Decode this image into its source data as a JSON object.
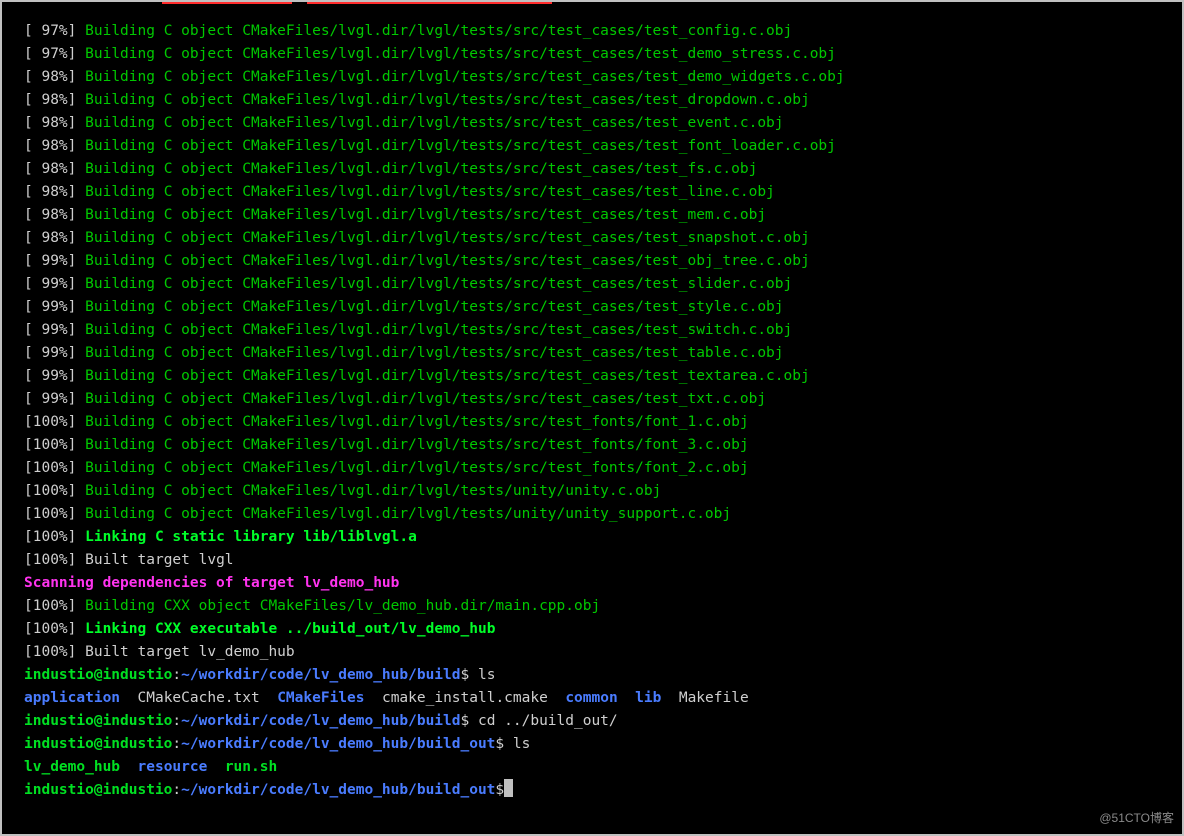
{
  "lines": [
    {
      "pct": " 97%",
      "kind": "build",
      "text": "Building C object CMakeFiles/lvgl.dir/lvgl/tests/src/test_cases/test_config.c.obj"
    },
    {
      "pct": " 97%",
      "kind": "build",
      "text": "Building C object CMakeFiles/lvgl.dir/lvgl/tests/src/test_cases/test_demo_stress.c.obj"
    },
    {
      "pct": " 98%",
      "kind": "build",
      "text": "Building C object CMakeFiles/lvgl.dir/lvgl/tests/src/test_cases/test_demo_widgets.c.obj"
    },
    {
      "pct": " 98%",
      "kind": "build",
      "text": "Building C object CMakeFiles/lvgl.dir/lvgl/tests/src/test_cases/test_dropdown.c.obj"
    },
    {
      "pct": " 98%",
      "kind": "build",
      "text": "Building C object CMakeFiles/lvgl.dir/lvgl/tests/src/test_cases/test_event.c.obj"
    },
    {
      "pct": " 98%",
      "kind": "build",
      "text": "Building C object CMakeFiles/lvgl.dir/lvgl/tests/src/test_cases/test_font_loader.c.obj"
    },
    {
      "pct": " 98%",
      "kind": "build",
      "text": "Building C object CMakeFiles/lvgl.dir/lvgl/tests/src/test_cases/test_fs.c.obj"
    },
    {
      "pct": " 98%",
      "kind": "build",
      "text": "Building C object CMakeFiles/lvgl.dir/lvgl/tests/src/test_cases/test_line.c.obj"
    },
    {
      "pct": " 98%",
      "kind": "build",
      "text": "Building C object CMakeFiles/lvgl.dir/lvgl/tests/src/test_cases/test_mem.c.obj"
    },
    {
      "pct": " 98%",
      "kind": "build",
      "text": "Building C object CMakeFiles/lvgl.dir/lvgl/tests/src/test_cases/test_snapshot.c.obj"
    },
    {
      "pct": " 99%",
      "kind": "build",
      "text": "Building C object CMakeFiles/lvgl.dir/lvgl/tests/src/test_cases/test_obj_tree.c.obj"
    },
    {
      "pct": " 99%",
      "kind": "build",
      "text": "Building C object CMakeFiles/lvgl.dir/lvgl/tests/src/test_cases/test_slider.c.obj"
    },
    {
      "pct": " 99%",
      "kind": "build",
      "text": "Building C object CMakeFiles/lvgl.dir/lvgl/tests/src/test_cases/test_style.c.obj"
    },
    {
      "pct": " 99%",
      "kind": "build",
      "text": "Building C object CMakeFiles/lvgl.dir/lvgl/tests/src/test_cases/test_switch.c.obj"
    },
    {
      "pct": " 99%",
      "kind": "build",
      "text": "Building C object CMakeFiles/lvgl.dir/lvgl/tests/src/test_cases/test_table.c.obj"
    },
    {
      "pct": " 99%",
      "kind": "build",
      "text": "Building C object CMakeFiles/lvgl.dir/lvgl/tests/src/test_cases/test_textarea.c.obj"
    },
    {
      "pct": " 99%",
      "kind": "build",
      "text": "Building C object CMakeFiles/lvgl.dir/lvgl/tests/src/test_cases/test_txt.c.obj"
    },
    {
      "pct": "100%",
      "kind": "build",
      "text": "Building C object CMakeFiles/lvgl.dir/lvgl/tests/src/test_fonts/font_1.c.obj"
    },
    {
      "pct": "100%",
      "kind": "build",
      "text": "Building C object CMakeFiles/lvgl.dir/lvgl/tests/src/test_fonts/font_3.c.obj"
    },
    {
      "pct": "100%",
      "kind": "build",
      "text": "Building C object CMakeFiles/lvgl.dir/lvgl/tests/src/test_fonts/font_2.c.obj"
    },
    {
      "pct": "100%",
      "kind": "build",
      "text": "Building C object CMakeFiles/lvgl.dir/lvgl/tests/unity/unity.c.obj"
    },
    {
      "pct": "100%",
      "kind": "build",
      "text": "Building C object CMakeFiles/lvgl.dir/lvgl/tests/unity/unity_support.c.obj"
    },
    {
      "pct": "100%",
      "kind": "link",
      "text": "Linking C static library lib/liblvgl.a"
    },
    {
      "pct": "100%",
      "kind": "done",
      "text": "Built target lvgl"
    },
    {
      "kind": "scan",
      "text": "Scanning dependencies of target lv_demo_hub"
    },
    {
      "pct": "100%",
      "kind": "build",
      "text": "Building CXX object CMakeFiles/lv_demo_hub.dir/main.cpp.obj"
    },
    {
      "pct": "100%",
      "kind": "link",
      "text": "Linking CXX executable ../build_out/lv_demo_hub"
    },
    {
      "pct": "100%",
      "kind": "done",
      "text": "Built target lv_demo_hub"
    }
  ],
  "prompts": [
    {
      "user": "industio@industio",
      "sep": ":",
      "path": "~/workdir/code/lv_demo_hub/build",
      "cmd": "ls"
    },
    {
      "user": "industio@industio",
      "sep": ":",
      "path": "~/workdir/code/lv_demo_hub/build",
      "cmd": "cd ../build_out/"
    },
    {
      "user": "industio@industio",
      "sep": ":",
      "path": "~/workdir/code/lv_demo_hub/build_out",
      "cmd": "ls"
    },
    {
      "user": "industio@industio",
      "sep": ":",
      "path": "~/workdir/code/lv_demo_hub/build_out",
      "cmd": ""
    }
  ],
  "ls1": {
    "application": "application",
    "cache": "CMakeCache.txt",
    "files": "CMakeFiles",
    "install": "cmake_install.cmake",
    "common": "common",
    "lib": "lib",
    "make": "Makefile"
  },
  "ls2": {
    "demo": "lv_demo_hub",
    "resource": "resource",
    "run": "run.sh"
  },
  "dollar": "$",
  "watermark": "@51CTO博客"
}
